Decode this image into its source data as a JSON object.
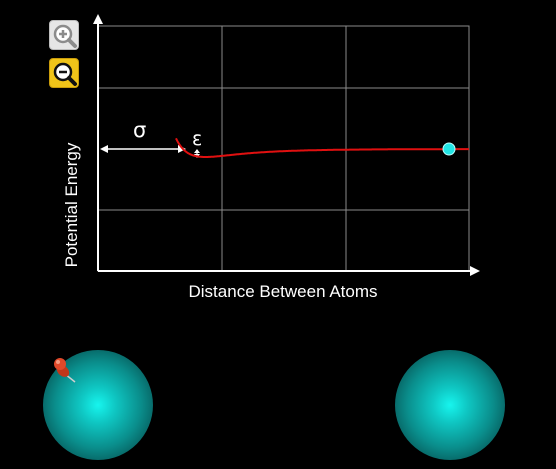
{
  "axes": {
    "ylabel": "Potential Energy",
    "xlabel": "Distance Between Atoms"
  },
  "annotations": {
    "sigma": "σ",
    "epsilon": "ε"
  },
  "icons": {
    "zoom_in": "zoom-in-magnifier-icon",
    "zoom_out": "zoom-out-magnifier-icon",
    "pin": "push-pin-icon"
  },
  "colors": {
    "background": "#000000",
    "curve": "#e01010",
    "marker": "#22e6e6",
    "atom": "#17f5ee",
    "zoom_out_button": "#f0c419",
    "grid": "#8a8a8a"
  }
}
